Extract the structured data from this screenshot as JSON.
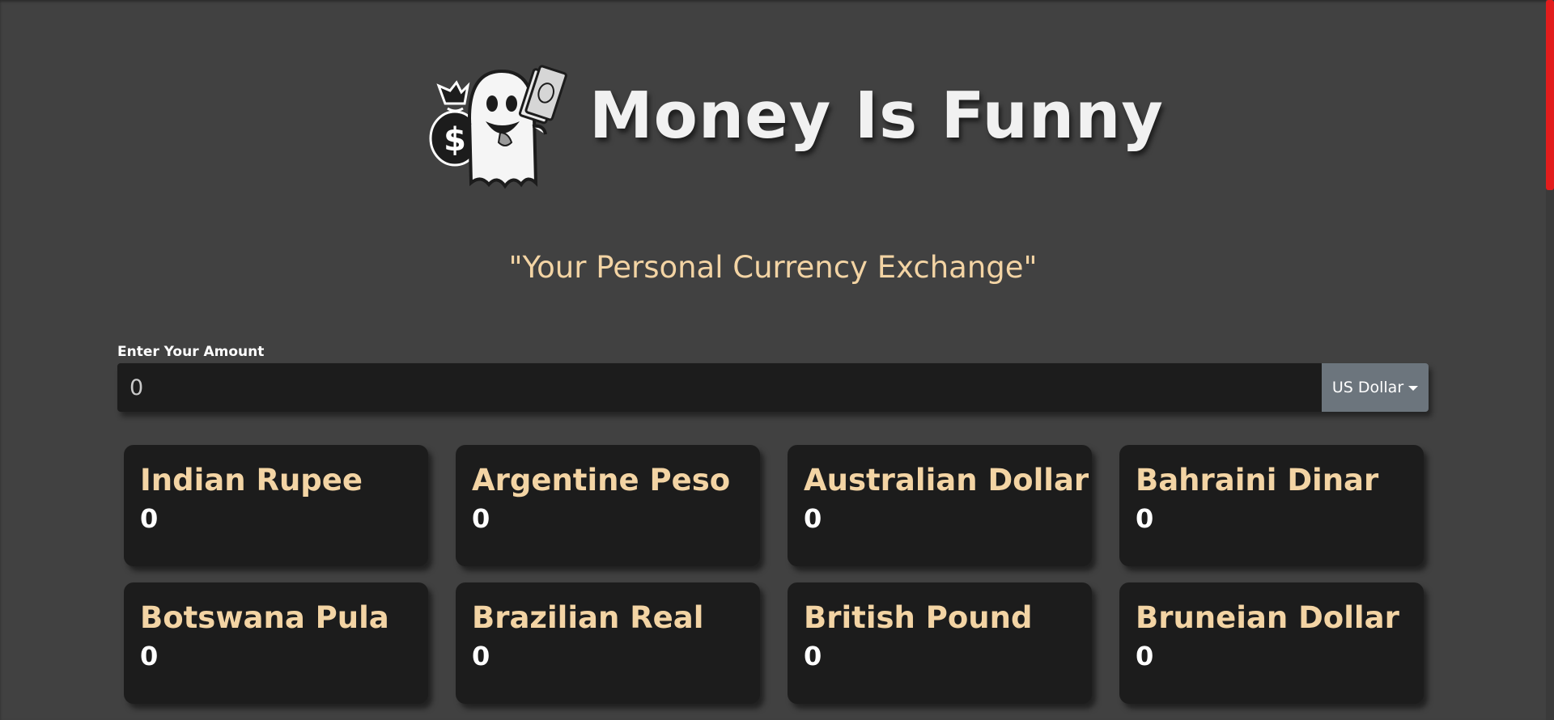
{
  "header": {
    "title": "Money Is Funny",
    "tagline": "\"Your Personal Currency Exchange\"",
    "logo_icon": "ghost-holding-money-icon",
    "brand_colors": {
      "title": "#f1f1f1",
      "accent": "#f3d4a4",
      "background": "#414141",
      "card": "#1c1c1c",
      "scroll_thumb": "#e21c1c"
    }
  },
  "converter": {
    "label": "Enter Your Amount",
    "amount_value": "0",
    "base_currency": "US Dollar"
  },
  "currencies": [
    {
      "name": "Indian Rupee",
      "value": "0"
    },
    {
      "name": "Argentine Peso",
      "value": "0"
    },
    {
      "name": "Australian Dollar",
      "value": "0"
    },
    {
      "name": "Bahraini Dinar",
      "value": "0"
    },
    {
      "name": "Botswana Pula",
      "value": "0"
    },
    {
      "name": "Brazilian Real",
      "value": "0"
    },
    {
      "name": "British Pound",
      "value": "0"
    },
    {
      "name": "Bruneian Dollar",
      "value": "0"
    }
  ]
}
